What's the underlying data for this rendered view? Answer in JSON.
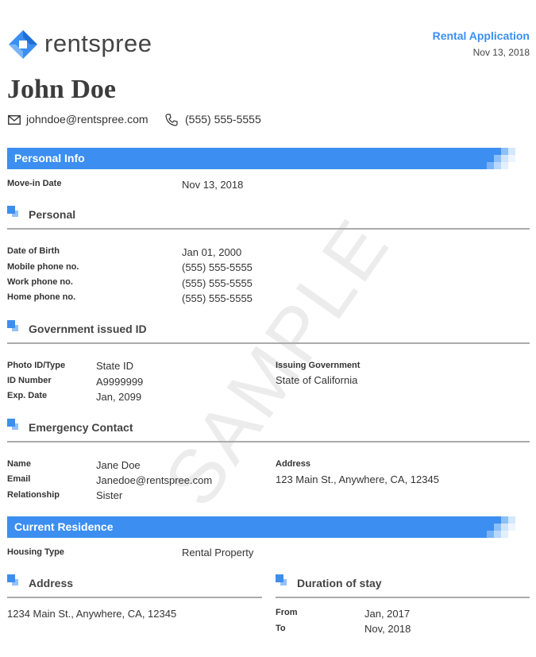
{
  "header": {
    "brand": "rentspree",
    "doc_title": "Rental Application",
    "doc_date": "Nov 13, 2018"
  },
  "applicant": {
    "name": "John Doe",
    "email": "johndoe@rentspree.com",
    "phone": "(555) 555-5555"
  },
  "watermark": "SAMPLE",
  "personal_info": {
    "band_title": "Personal Info",
    "move_in": {
      "label": "Move-in Date",
      "value": "Nov 13, 2018"
    },
    "personal": {
      "title": "Personal",
      "rows": [
        {
          "label": "Date of Birth",
          "value": "Jan 01, 2000"
        },
        {
          "label": "Mobile phone no.",
          "value": "(555) 555-5555"
        },
        {
          "label": "Work phone no.",
          "value": "(555) 555-5555"
        },
        {
          "label": "Home phone no.",
          "value": "(555) 555-5555"
        }
      ]
    },
    "government_id": {
      "title": "Government issued ID",
      "rows": [
        {
          "label": "Photo ID/Type",
          "value": "State ID"
        },
        {
          "label": "ID Number",
          "value": "A9999999"
        },
        {
          "label": "Exp. Date",
          "value": "Jan, 2099"
        }
      ],
      "issuing_label": "Issuing Government",
      "issuing_value": "State of California"
    },
    "emergency": {
      "title": "Emergency Contact",
      "rows": [
        {
          "label": "Name",
          "value": "Jane Doe"
        },
        {
          "label": "Email",
          "value": "Janedoe@rentspree.com"
        },
        {
          "label": "Relationship",
          "value": "Sister"
        }
      ],
      "address_label": "Address",
      "address_value": "123 Main St., Anywhere, CA, 12345"
    }
  },
  "current_residence": {
    "band_title": "Current Residence",
    "housing": {
      "label": "Housing Type",
      "value": "Rental Property"
    },
    "address": {
      "title": "Address",
      "value": "1234 Main St., Anywhere, CA, 12345"
    },
    "duration": {
      "title": "Duration of stay",
      "from_label": "From",
      "from_value": "Jan, 2017",
      "to_label": "To",
      "to_value": "Nov, 2018"
    }
  },
  "colors": {
    "accent": "#3c8ff0",
    "text": "#333333",
    "rule": "#ababab"
  },
  "icons": [
    "rentspree-logo-icon",
    "mail-icon",
    "phone-icon",
    "section-square-icon"
  ]
}
